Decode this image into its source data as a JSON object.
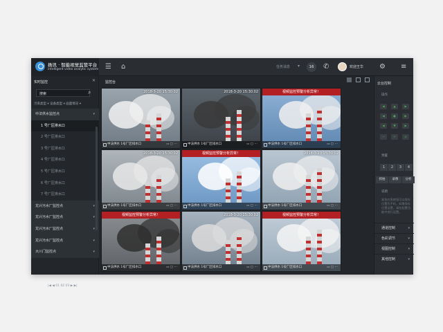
{
  "app": {
    "title": "扬讯 · 智能视觉监管平台",
    "subtitle": "intelligent video analytic system"
  },
  "header": {
    "task_label": "任务消息",
    "notification_count": "16",
    "welcome": "欢迎王华"
  },
  "left_panel": {
    "title": "实时监控",
    "search_value": "搜索",
    "filters": [
      "污染类型 ▾",
      "设备类型 ▾",
      "画面情况 ▾"
    ],
    "tree": [
      {
        "label": "中法供水监控点",
        "type": "group",
        "caret": "▾"
      },
      {
        "label": "1 号厂区排水口",
        "type": "child-active"
      },
      {
        "label": "2 号厂区排水口",
        "type": "child"
      },
      {
        "label": "3 号厂区排水口",
        "type": "child"
      },
      {
        "label": "4 号厂区排水口",
        "type": "child"
      },
      {
        "label": "5 号厂区排水口",
        "type": "child"
      },
      {
        "label": "6 号厂区排水口",
        "type": "child"
      },
      {
        "label": "7 号厂区排水口",
        "type": "child"
      },
      {
        "label": "龙兴污水厂监控点",
        "type": "group",
        "caret": "▾"
      },
      {
        "label": "龙兴污水厂监控点",
        "type": "group",
        "caret": "▾"
      },
      {
        "label": "龙兴污水厂监控点",
        "type": "group",
        "caret": "▾"
      },
      {
        "label": "龙兴污水厂监控点",
        "type": "group",
        "caret": "▾"
      },
      {
        "label": "大川门监控点",
        "type": "group",
        "caret": "▾"
      }
    ],
    "pager": "|◀  ◀   01   02   03   ▶   ▶|"
  },
  "center": {
    "title": "监控台",
    "cells": [
      {
        "alarm": "",
        "timestamp": "2018-3-20  15:30:02",
        "caption": "中法供水 1号厂区排水口"
      },
      {
        "alarm": "",
        "timestamp": "2018-3-20  15:30:02",
        "caption": "中法供水 1号厂区排水口"
      },
      {
        "alarm": "视频监控预警分析异常！",
        "timestamp": "",
        "caption": "中法供水 1号厂区排水口"
      },
      {
        "alarm": "",
        "timestamp": "2018-3-20  15:30:02",
        "caption": "中法供水 1号厂区排水口"
      },
      {
        "alarm": "视频监控预警分析异常！",
        "timestamp": "",
        "caption": "中法供水 1号厂区排水口"
      },
      {
        "alarm": "",
        "timestamp": "2018-3-20  15:30:02",
        "caption": "中法供水 1号厂区排水口"
      },
      {
        "alarm": "视频监控预警分析异常！",
        "timestamp": "",
        "caption": "中法供水 1号厂区排水口"
      },
      {
        "alarm": "",
        "timestamp": "2018-3-20  15:30:02",
        "caption": "中法供水 1号厂区排水口"
      },
      {
        "alarm": "视频监控预警分析异常！",
        "timestamp": "",
        "caption": "中法供水 1号厂区排水口"
      }
    ]
  },
  "right_panel": {
    "title": "云台控制",
    "operate": "操作",
    "preset": "预置",
    "presets": [
      "1",
      "2",
      "3",
      "4"
    ],
    "actions": [
      "抓拍",
      "录像",
      "分析"
    ],
    "desc_title": "说明",
    "desc_text": "紧急应急按钮可以保存位置为手机，如需保存位置设置，请在配置功能中进行设置。",
    "sections": [
      "通道控制",
      "色彩调节",
      "视图控制",
      "其他控制"
    ]
  },
  "colors": {
    "alarm_red": "#b32024",
    "brand_blue": "#3a8fd9",
    "panel_dark": "#23272b"
  }
}
